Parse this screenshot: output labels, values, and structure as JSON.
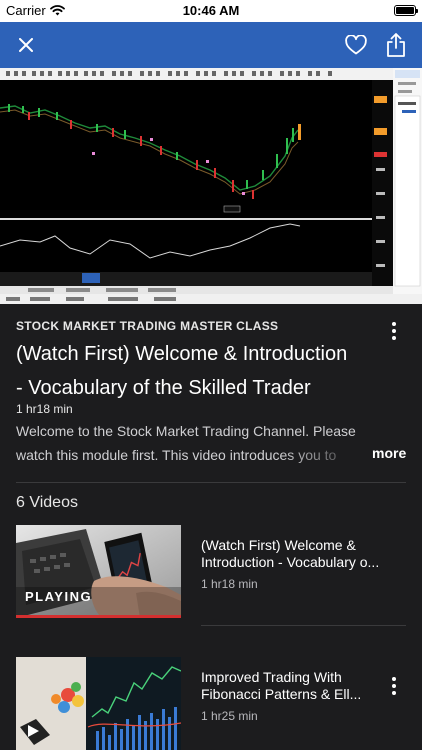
{
  "status_bar": {
    "carrier": "Carrier",
    "time": "10:46 AM"
  },
  "nav": {
    "close_icon": "close-icon",
    "favorite_icon": "heart-icon",
    "share_icon": "share-icon"
  },
  "course": {
    "label": "STOCK MARKET TRADING MASTER CLASS",
    "title_line1": "(Watch First) Welcome & Introduction",
    "title_line2": "- Vocabulary of the Skilled Trader",
    "duration": "1 hr18 min",
    "description": "Welcome to the Stock Market Trading Channel.  Please watch this module first.   This video introduces you to",
    "more_label": "more"
  },
  "videos": {
    "count_label": "6 Videos",
    "items": [
      {
        "title_line1": "(Watch First) Welcome &",
        "title_line2": "Introduction - Vocabulary o...",
        "duration": "1 hr18 min",
        "badge": "PLAYING",
        "progress": 1.0
      },
      {
        "title_line1": "Improved Trading With",
        "title_line2": "Fibonacci Patterns & Ell...",
        "duration": "1 hr25 min",
        "progress": 0.0
      }
    ]
  },
  "colors": {
    "nav_blue": "#2d62b8",
    "background": "#1c1c1e",
    "progress_red": "#d32f2f"
  }
}
